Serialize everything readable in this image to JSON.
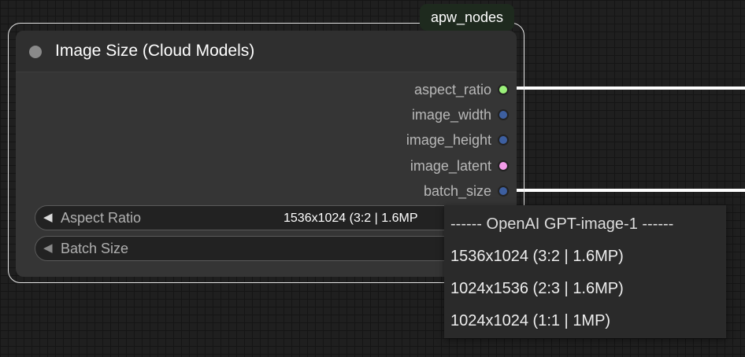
{
  "node": {
    "badge": "apw_nodes",
    "title": "Image Size (Cloud Models)",
    "outputs": [
      {
        "label": "aspect_ratio",
        "color": "#9bf07a"
      },
      {
        "label": "image_width",
        "color": "#3d5fa0"
      },
      {
        "label": "image_height",
        "color": "#3d5fa0"
      },
      {
        "label": "image_latent",
        "color": "#f29be8"
      },
      {
        "label": "batch_size",
        "color": "#3d5fa0"
      }
    ],
    "widgets": {
      "aspect_ratio": {
        "label": "Aspect Ratio",
        "value": "1536x1024 (3:2 | 1.6MP"
      },
      "batch_size": {
        "label": "Batch Size"
      }
    }
  },
  "dropdown": {
    "header": "------ OpenAI GPT-image-1 ------",
    "options": [
      "1536x1024 (3:2 | 1.6MP)",
      "1024x1536 (2:3 | 1.6MP)",
      "1024x1024 (1:1 | 1MP)"
    ]
  },
  "icons": {
    "left_arrow": "◀"
  }
}
